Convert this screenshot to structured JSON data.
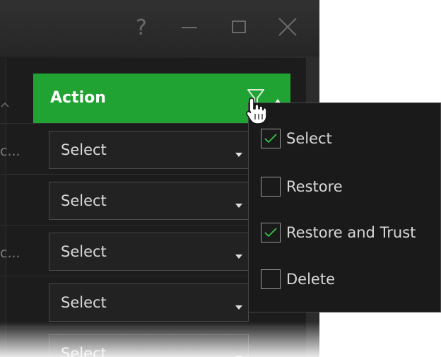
{
  "window": {
    "help_icon": "question-mark-icon",
    "minimize_icon": "minimize-icon",
    "maximize_icon": "maximize-icon",
    "close_icon": "close-icon"
  },
  "table": {
    "column_header": "Action",
    "header_color": "#21a334",
    "header_icons": [
      "filter-icon",
      "sort-ascending-icon"
    ],
    "truncated_cells": [
      "c...",
      "c..."
    ],
    "rows": [
      {
        "value": "Select"
      },
      {
        "value": "Select"
      },
      {
        "value": "Select"
      },
      {
        "value": "Select"
      },
      {
        "value": "Select"
      }
    ]
  },
  "filter_dropdown": {
    "options": [
      {
        "label": "Select",
        "checked": true
      },
      {
        "label": "Restore",
        "checked": false
      },
      {
        "label": "Restore and Trust",
        "checked": true
      },
      {
        "label": "Delete",
        "checked": false
      }
    ],
    "check_color": "#2fb344"
  }
}
